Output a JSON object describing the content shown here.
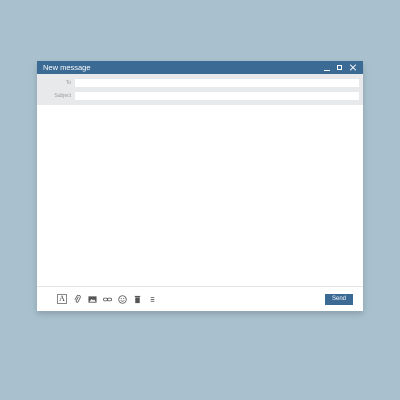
{
  "window": {
    "title": "New message"
  },
  "fields": {
    "to_label": "To",
    "subject_label": "Subject"
  },
  "toolbar": {
    "format_glyph": "A",
    "send_label": "Send",
    "icons": [
      "text-format-icon",
      "paperclip-icon",
      "image-icon",
      "link-icon",
      "emoji-icon",
      "trash-icon",
      "more-options-icon"
    ]
  },
  "colors": {
    "titlebar": "#3b6a95",
    "background": "#a9c1ce",
    "send_button": "#3b6a95"
  }
}
